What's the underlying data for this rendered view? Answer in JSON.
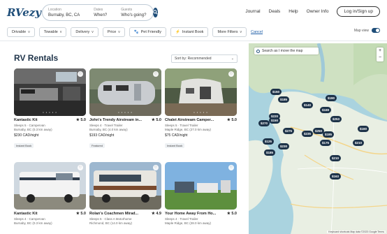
{
  "header": {
    "logo": "RVezy",
    "location_label": "Location",
    "location_value": "Burnaby, BC, CA",
    "dates_label": "Dates",
    "dates_value": "When?",
    "guests_label": "Guests",
    "guests_value": "Who's going?",
    "nav": [
      "Journal",
      "Deals",
      "Help",
      "Owner Info"
    ],
    "signup_label": "Log in/Sign up"
  },
  "filters": {
    "chips": [
      {
        "label": "Drivable",
        "chev": "v"
      },
      {
        "label": "Towable",
        "chev": "v"
      },
      {
        "label": "Delivery",
        "chev": "v"
      },
      {
        "label": "Price",
        "chev": "v"
      },
      {
        "label": "Pet Friendly",
        "chev": ""
      },
      {
        "label": "Instant Book",
        "chev": ""
      },
      {
        "label": "More Filters",
        "chev": "v"
      }
    ],
    "cancel_label": "Cancel",
    "map_view_label": "Map view"
  },
  "main": {
    "title": "RV Rentals",
    "sort_label": "Sort by: Recommended",
    "listings": [
      {
        "title": "Kantastic Kit",
        "rating": "5.0",
        "line1": "Sleeps 5 · Campervan",
        "line2": "Burnaby, BC (0.3 km away)",
        "price": "$230 CAD/night",
        "badge": "Instant Book"
      },
      {
        "title": "John's Trendy Airstream in...",
        "rating": "5.0",
        "line1": "Sleeps 4 · Travel Trailer",
        "line2": "Burnaby, BC (4.0 km away)",
        "price": "$193 CAD/night",
        "badge": "Featured"
      },
      {
        "title": "Chalet Airstream Camper...",
        "rating": "5.0",
        "line1": "Sleeps 5 · Travel Trailer",
        "line2": "Maple Ridge, BC (27.0 km away)",
        "price": "$75 CAD/night",
        "badge": "Instant Book"
      },
      {
        "title": "Kantastic Kit",
        "rating": "5.0",
        "line1": "Sleeps 4 · Campervan",
        "line2": "Burnaby, BC (0.3 km away)",
        "price": "",
        "badge": ""
      },
      {
        "title": "Rolan's Coachmen Mirad...",
        "rating": "4.9",
        "line1": "Sleeps 5 · Class A Motorhome",
        "line2": "Richmond, BC (14.0 km away)",
        "price": "",
        "badge": ""
      },
      {
        "title": "Your Home Away From Ho...",
        "rating": "5.0",
        "line1": "Sleeps 4 · Travel Trailer",
        "line2": "Maple Ridge, BC (28.0 km away)",
        "price": "",
        "badge": ""
      }
    ]
  },
  "map": {
    "search_label": "Search as I move the map",
    "zoom_in": "+",
    "zoom_out": "−",
    "pins": [
      "$150",
      "$185",
      "$220",
      "$270",
      "$140",
      "$190",
      "$169",
      "$253",
      "$275",
      "$250",
      "$235",
      "$185",
      "$160",
      "$175",
      "$125",
      "$230",
      "$210",
      "$185",
      "$210",
      "$163",
      "$150"
    ],
    "attribution": "Keyboard shortcuts  Map data ©2023 Google  Terms"
  },
  "colors": {
    "brand": "#1e3349",
    "accent": "#1f4e79",
    "water": "#aad3df",
    "land": "#e9efe3"
  },
  "icons": [
    "search-icon",
    "heart-icon",
    "star-icon",
    "chevron-down-icon",
    "lightning-icon",
    "pet-icon"
  ]
}
